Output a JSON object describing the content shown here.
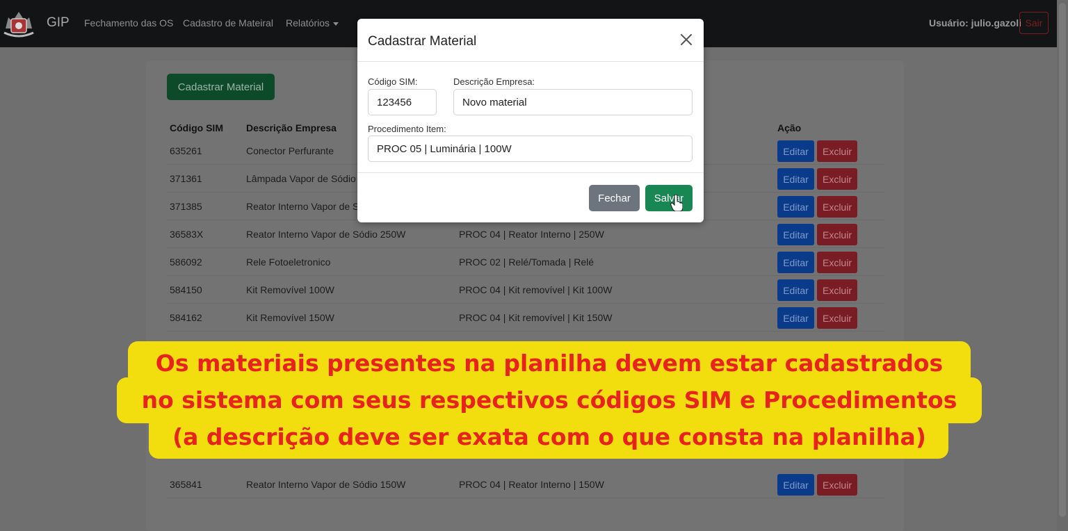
{
  "navbar": {
    "brand": "GIP",
    "links": [
      "Fechamento das OS",
      "Cadastro de Mateiral",
      "Relatórios"
    ],
    "user": "Usuário: julio.gazoli",
    "logout": "Sair",
    "logo_icon": "city-crest-logo"
  },
  "page": {
    "add_button": "Cadastrar Material",
    "table": {
      "headers": [
        "Código SIM",
        "Descrição Empresa",
        "Procedimento Item",
        "Ação"
      ],
      "rows": [
        {
          "code": "635261",
          "desc": "Conector Perfurante",
          "proc": ""
        },
        {
          "code": "371361",
          "desc": "Lâmpada Vapor de Sódio",
          "proc": ""
        },
        {
          "code": "371385",
          "desc": "Reator Interno Vapor de S",
          "proc": ""
        },
        {
          "code": "36583X",
          "desc": "Reator Interno Vapor de Sódio 250W",
          "proc": "PROC 04 | Reator Interno | 250W"
        },
        {
          "code": "586092",
          "desc": "Rele Fotoeletronico",
          "proc": "PROC 02 | Relé/Tomada | Relé"
        },
        {
          "code": "584150",
          "desc": "Kit Removível 100W",
          "proc": "PROC 04 | Kit removível | Kit 100W"
        },
        {
          "code": "584162",
          "desc": "Kit Removível 150W",
          "proc": "PROC 04 | Kit removível | Kit 150W"
        },
        {
          "code": "365841",
          "desc": "Reator Interno Vapor de Sódio 150W",
          "proc": "PROC 04 | Reator Interno | 150W"
        }
      ],
      "edit_label": "Editar",
      "delete_label": "Excluir"
    }
  },
  "modal": {
    "title": "Cadastrar Material",
    "code_label": "Código SIM:",
    "code_value": "123456",
    "desc_label": "Descrição Empresa:",
    "desc_value": "Novo material",
    "proc_label": "Procedimento Item:",
    "proc_value": "PROC 05 | Luminária | 100W",
    "close_button": "Fechar",
    "save_button": "Salvar"
  },
  "caption": {
    "lines": [
      "Os materiais presentes na planilha devem estar cadastrados",
      "no sistema com seus respectivos códigos SIM e Procedimentos",
      "(a descrição deve ser exata com o que consta na planilha)"
    ]
  },
  "colors": {
    "caption_bg": "#f2de0f",
    "caption_text": "#e8231c",
    "primary": "#0d6efd",
    "success": "#198754",
    "danger": "#dc3545",
    "secondary": "#6c757d"
  }
}
